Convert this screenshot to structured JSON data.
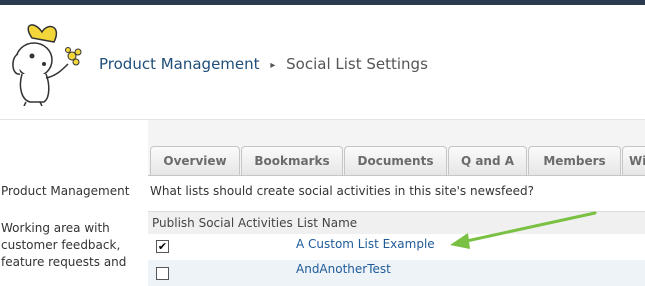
{
  "header": {
    "site_title": "Product Management",
    "separator": "▸",
    "page_title": "Social List Settings"
  },
  "tabs": [
    {
      "label": "Overview"
    },
    {
      "label": "Bookmarks"
    },
    {
      "label": "Documents"
    },
    {
      "label": "Q and A"
    },
    {
      "label": "Members"
    },
    {
      "label": "Wi"
    }
  ],
  "left_nav": {
    "title": "Product Management",
    "description": "Working area with customer feedback, feature requests and"
  },
  "main": {
    "question": "What lists should create social activities in this site's newsfeed?",
    "columns": [
      "Publish Social Activities",
      "List Name"
    ],
    "rows": [
      {
        "checked_mark": "✔",
        "name": "A Custom List Example"
      },
      {
        "checked_mark": "",
        "name": "AndAnotherTest"
      }
    ]
  },
  "colors": {
    "accent_arrow": "#7ac143",
    "link": "#1f5b99",
    "title": "#1f4e79"
  },
  "icons": {
    "logo": "cartoon-dog-logo",
    "breadcrumb_separator": "triangle-right-icon",
    "annotation": "green-arrow"
  }
}
